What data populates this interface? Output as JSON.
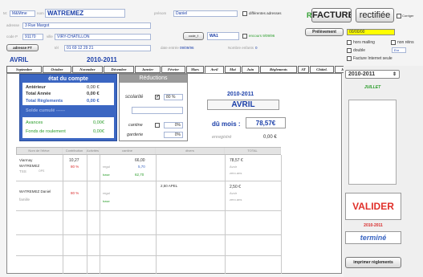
{
  "header": {
    "civilite": "M&Mme",
    "nom_label": "nom",
    "nom": "WATREMEZ",
    "prenom_label": "prénom",
    "prenom": "Daniel",
    "differentes_adresses": "différentes adresses",
    "adresse_label": "adresse",
    "adresse": "3 Rue Margot",
    "code_label": "code P",
    "code_postal": "91170",
    "ville_label": "ville",
    "ville": "VIRY-CHATILLON",
    "code_f_label": "code_f",
    "code_f": "WA1",
    "encours": "encours 9/09/96",
    "adresse_ft_btn": "adresse FT",
    "tel_label": "tél",
    "tel": "01 69 12 29 21",
    "date_entree_label": "date entrée",
    "date_entree": "09/09/96",
    "nombre_enfants_label": "Nombre enfants",
    "nombre_enfants": "0"
  },
  "actions": {
    "facture": "FACTURE",
    "rectifiee": "rectifiée",
    "corriger": "Corriger",
    "prelevement": "Prélèvement",
    "prelevement_date": "00/00/00",
    "hors_mailing": "hors mailing",
    "non_reins": "non réins",
    "double": "double",
    "enr": "Enr",
    "facture_internet": "Facture Internet seule"
  },
  "period": {
    "month": "AVRIL",
    "year": "2010-2011"
  },
  "tabs": [
    "Septembre",
    "Octobre",
    "Novembre",
    "Décembre",
    "Janvier",
    "Février",
    "Mars",
    "Avril",
    "Mai",
    "Juin",
    "Règlements",
    "AT",
    "Châtel.",
    "Juillet"
  ],
  "active_tab": "Avril",
  "etat": {
    "title": "état du compte",
    "anterieur_label": "Antérieur",
    "anterieur": "0,00 €",
    "total_annee_label": "Total Année",
    "total_annee": "0,00 €",
    "total_reglements_label": "Total Règlements",
    "total_reglements": "0,00 €",
    "solde_label": "Solde cumulé ------",
    "avances_label": "Avances",
    "avances": "0,00€",
    "fonds_label": "Fonds de roulement",
    "fonds": "0,00€"
  },
  "reductions": {
    "title": "Réductions",
    "scolarite_label": "scolarité",
    "scolarite_pct": "80 %",
    "cantine_label": "cantine",
    "cantine_pct": "0%",
    "garderie_label": "garderie",
    "garderie_pct": "0%"
  },
  "summary": {
    "year": "2010-2011",
    "month": "AVRIL",
    "du_mois_label": "dû mois :",
    "du_mois": "78,57€",
    "enregistre_label": "enregistré",
    "enregistre": "0,00 €"
  },
  "table": {
    "headers": [
      "Nom de l'élève",
      "Contribution",
      "Activités",
      "cantine",
      "divers",
      "TOTAL"
    ],
    "rows": [
      {
        "nom": "Viarmay",
        "nom2": "WATREMEZ",
        "classe": "TSS",
        "opt": "OPS",
        "contribution": "10,27",
        "pct": "80 %",
        "cantine": "66,00",
        "cantine2": "5,70",
        "cantine3": "62,70",
        "reg": "regul",
        "base": "base",
        "total": "78,57 €",
        "avoir": "Avoir",
        "zero": "zero.ans"
      },
      {
        "nom": "WATREMEZ Daniel",
        "nom2": "famille",
        "classe": "",
        "opt": "",
        "contribution": "",
        "pct": "80 %",
        "cantine": "",
        "cantine2": "",
        "cantine3": "",
        "reg": "regul",
        "base": "base",
        "divers": "2,50 APEL",
        "total": "2,50 €",
        "avoir": "Avoir",
        "zero": "zero.ans"
      }
    ]
  },
  "sidebar": {
    "year_select": "2010-2011",
    "month": "JUILLET",
    "valider": "VALIDER",
    "year2": "2010-2011",
    "termine": "terminé",
    "imprimer": "imprimer règlements"
  },
  "colors": {
    "blue_panel": "#3b66c2",
    "grey_panel": "#9a9a9a",
    "valider_red": "#e0302a",
    "link_blue": "#1a3ea8",
    "green": "#2a9d2a",
    "red": "#d92b2b",
    "yellow": "#ffff00"
  }
}
